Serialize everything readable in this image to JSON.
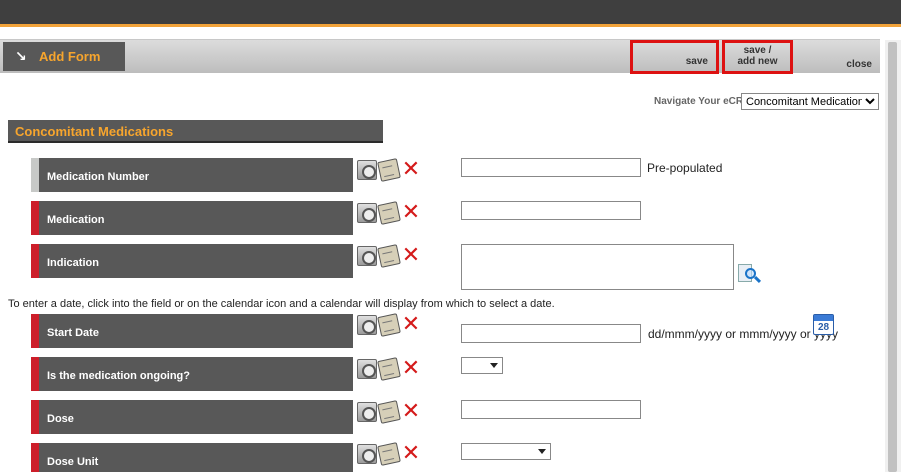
{
  "header": {
    "tab_label": "Add Form",
    "save_label": "save",
    "save_add_new_line1": "save /",
    "save_add_new_line2": "add new",
    "close_label": "close"
  },
  "navigate": {
    "label": "Navigate Your eCRF",
    "selected": "Concomitant Medications"
  },
  "section": {
    "title": "Concomitant Medications"
  },
  "instructions": "To enter a date, click into the field or on the calendar icon and a calendar will display from which to select a date.",
  "fields": [
    {
      "label": "Medication Number",
      "hint": "Pre-populated"
    },
    {
      "label": "Medication"
    },
    {
      "label": "Indication"
    },
    {
      "label": "Start Date",
      "hint": "dd/mmm/yyyy or mmm/yyyy or yyyy"
    },
    {
      "label": "Is the medication ongoing?"
    },
    {
      "label": "Dose"
    },
    {
      "label": "Dose Unit"
    }
  ],
  "calendar_icon_text": "28",
  "colors": {
    "accent": "#f7a52d",
    "label_bg": "#585858",
    "required_marker": "#cc1e2a",
    "highlight_border": "#dd1111"
  }
}
